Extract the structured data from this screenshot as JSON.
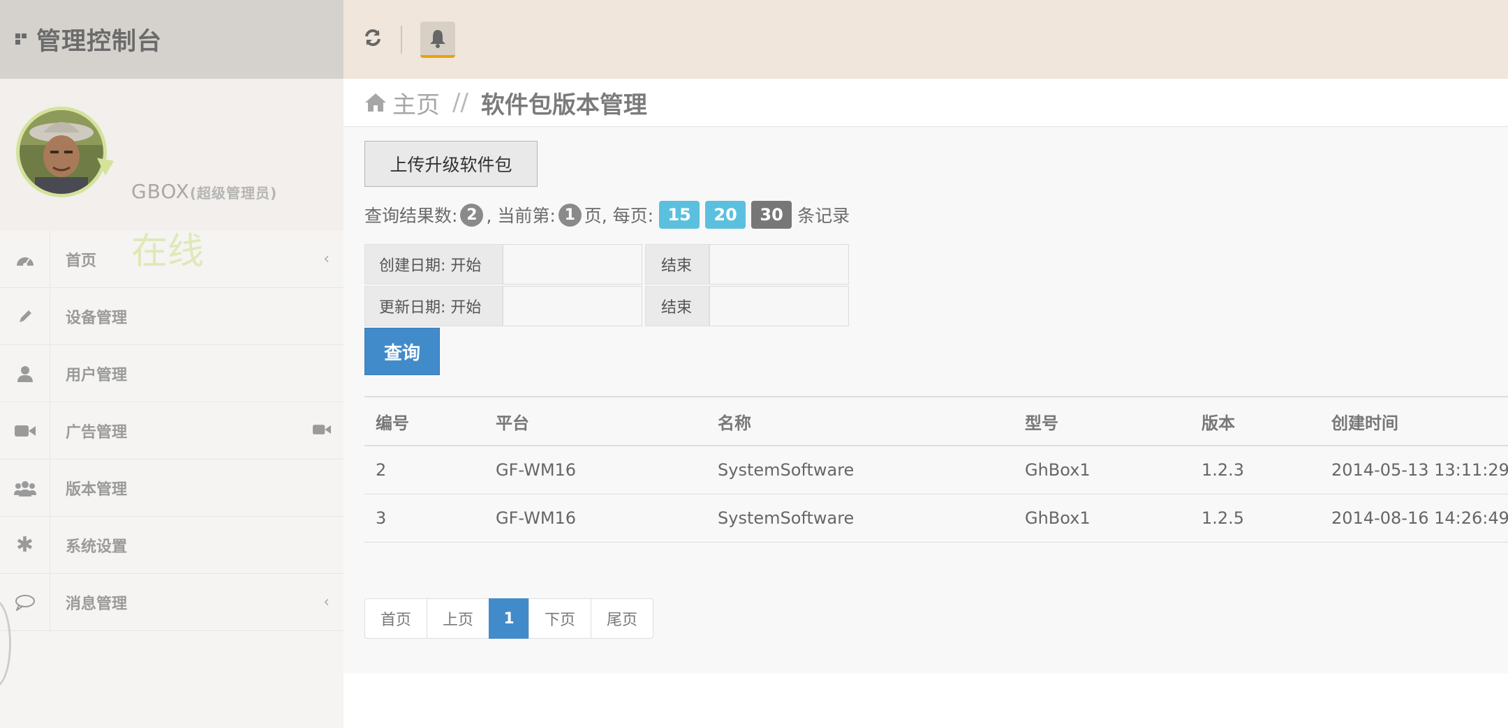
{
  "app": {
    "title": "管理控制台"
  },
  "profile": {
    "name": "GBOX",
    "role": "(超级管理员)",
    "status": "在线"
  },
  "sidebar": {
    "items": [
      {
        "label": "首页",
        "icon": "dashboard-icon",
        "caret": "‹"
      },
      {
        "label": "设备管理",
        "icon": "pencil-icon"
      },
      {
        "label": "用户管理",
        "icon": "user-icon"
      },
      {
        "label": "广告管理",
        "icon": "video-camera-icon"
      },
      {
        "label": "版本管理",
        "icon": "users-icon"
      },
      {
        "label": "系统设置",
        "icon": "asterisk-icon"
      },
      {
        "label": "消息管理",
        "icon": "comment-icon",
        "caret": "‹"
      }
    ]
  },
  "breadcrumb": {
    "home": "主页",
    "separator": "//",
    "current": "软件包版本管理"
  },
  "toolbar": {
    "upload_label": "上传升级软件包"
  },
  "query_info": {
    "total_label": "查询结果数:",
    "total": "2",
    "page_label": ", 当前第:",
    "page": "1",
    "per_page_label": "页, 每页:",
    "sizes": [
      "15",
      "20",
      "30"
    ],
    "records_label": "条记录"
  },
  "filter": {
    "created_start_label": "创建日期: 开始",
    "created_end_label": "结束",
    "updated_start_label": "更新日期: 开始",
    "updated_end_label": "结束",
    "query_button": "查询"
  },
  "table": {
    "headers": [
      "编号",
      "平台",
      "名称",
      "型号",
      "版本",
      "创建时间"
    ],
    "rows": [
      [
        "2",
        "GF-WM16",
        "SystemSoftware",
        "GhBox1",
        "1.2.3",
        "2014-05-13 13:11:29"
      ],
      [
        "3",
        "GF-WM16",
        "SystemSoftware",
        "GhBox1",
        "1.2.5",
        "2014-08-16 14:26:49"
      ]
    ]
  },
  "pagination": {
    "first": "首页",
    "prev": "上页",
    "current": "1",
    "next": "下页",
    "last": "尾页"
  },
  "colors": {
    "primary": "#428bca",
    "info": "#5bc0de",
    "topbar": "#f0e6dc",
    "sidebar": "#f5f4f2",
    "bell_underline": "#e8a300"
  }
}
